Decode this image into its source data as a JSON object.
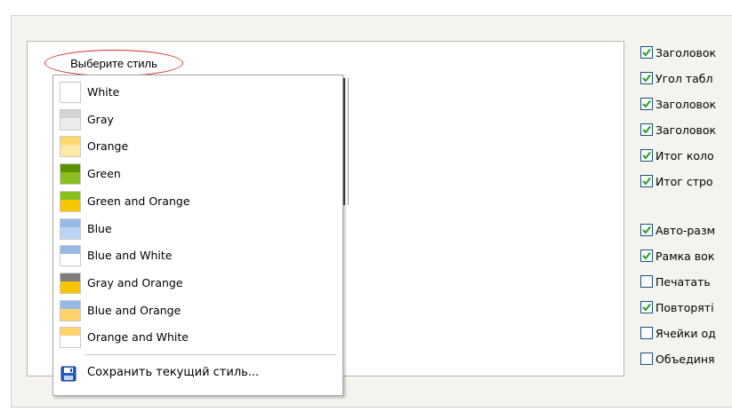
{
  "style_label": "Выберите стиль",
  "style_menu": {
    "items": [
      {
        "label": "White",
        "top_color": "#ffffff",
        "bottom_color": "#ffffff"
      },
      {
        "label": "Gray",
        "top_color": "#d4d4d4",
        "bottom_color": "#ececec"
      },
      {
        "label": "Orange",
        "top_color": "#fdd866",
        "bottom_color": "#fde9a4"
      },
      {
        "label": "Green",
        "top_color": "#5c9200",
        "bottom_color": "#8cbf1e"
      },
      {
        "label": "Green and Orange",
        "top_color": "#87c21c",
        "bottom_color": "#f8c600"
      },
      {
        "label": "Blue",
        "top_color": "#98b9e8",
        "bottom_color": "#bcd3f5"
      },
      {
        "label": "Blue and White",
        "top_color": "#98b9e8",
        "bottom_color": "#ffffff"
      },
      {
        "label": "Gray and Orange",
        "top_color": "#7e7e7e",
        "bottom_color": "#f9c500"
      },
      {
        "label": "Blue and Orange",
        "top_color": "#98b9e8",
        "bottom_color": "#fdd36a"
      },
      {
        "label": "Orange and White",
        "top_color": "#fdd36a",
        "bottom_color": "#ffffff"
      }
    ],
    "save_label": "Сохранить текущий стиль..."
  },
  "options": [
    {
      "label": "Заголовок",
      "checked": true
    },
    {
      "label": "Угол табл",
      "checked": true
    },
    {
      "label": "Заголовок",
      "checked": true
    },
    {
      "label": "Заголовок",
      "checked": true
    },
    {
      "label": "Итог коло",
      "checked": true
    },
    {
      "label": "Итог стро",
      "checked": true
    },
    {
      "label": "Авто-разм",
      "checked": true
    },
    {
      "label": "Рамка вок",
      "checked": true
    },
    {
      "label": "Печатать",
      "checked": false
    },
    {
      "label": "Повторяті",
      "checked": true
    },
    {
      "label": "Ячейки од",
      "checked": false
    },
    {
      "label": "Объединя",
      "checked": false
    }
  ],
  "colors": {
    "panel_background": "#f4f3ee",
    "checkbox_border": "#1c5180",
    "checkmark": "#21a121",
    "highlight_ellipse": "#d0312d"
  }
}
